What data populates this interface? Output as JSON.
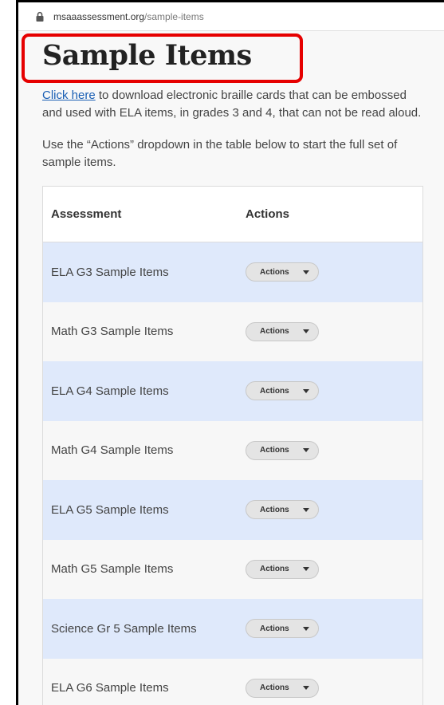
{
  "browser": {
    "url_domain": "msaaassessment.org",
    "url_path": "/sample-items"
  },
  "page": {
    "title": "Sample Items",
    "intro": {
      "link_text": "Click here",
      "rest": " to download electronic braille cards that can be embossed and used with ELA items, in grades 3 and 4, that can not be read aloud."
    },
    "instructions": "Use the “Actions” dropdown in the table below to start the full set of sample items."
  },
  "table": {
    "headers": {
      "assessment": "Assessment",
      "actions": "Actions"
    },
    "rows": [
      {
        "name": "ELA G3 Sample Items",
        "action_label": "Actions"
      },
      {
        "name": "Math G3 Sample Items",
        "action_label": "Actions"
      },
      {
        "name": "ELA G4 Sample Items",
        "action_label": "Actions"
      },
      {
        "name": "Math G4 Sample Items",
        "action_label": "Actions"
      },
      {
        "name": "ELA G5 Sample Items",
        "action_label": "Actions"
      },
      {
        "name": "Math G5 Sample Items",
        "action_label": "Actions"
      },
      {
        "name": "Science Gr 5 Sample Items",
        "action_label": "Actions"
      },
      {
        "name": "ELA G6 Sample Items",
        "action_label": "Actions"
      }
    ]
  },
  "icons": {
    "lock": "lock-icon",
    "dropdown": "caret-down-icon"
  },
  "colors": {
    "highlight": "#e60000",
    "link": "#1a5fb4",
    "row_alt": "#dfe9fb"
  }
}
